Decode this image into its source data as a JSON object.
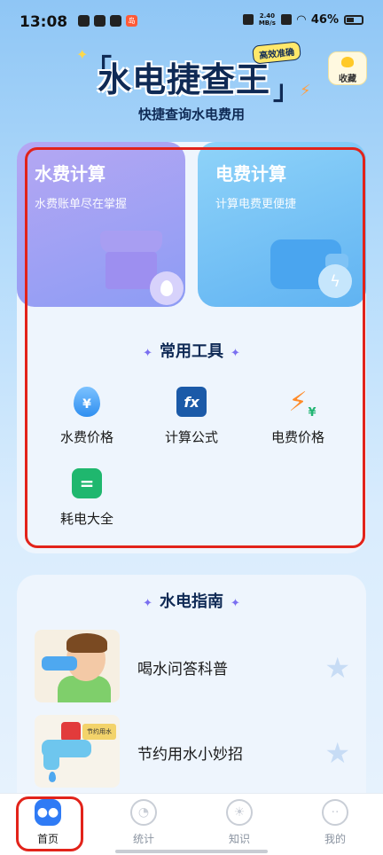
{
  "status_bar": {
    "time": "13:08",
    "net_speed_value": "2.40",
    "net_speed_unit": "MB/s",
    "battery": "46%",
    "app_badge_text": "岛"
  },
  "header": {
    "title": "水电捷查王",
    "badge": "高效准确",
    "subtitle": "快捷查询水电费用",
    "favorite_label": "收藏"
  },
  "calc_cards": {
    "water": {
      "title": "水费计算",
      "subtitle": "水费账单尽在掌握"
    },
    "electric": {
      "title": "电费计算",
      "subtitle": "计算电费更便捷"
    }
  },
  "tools": {
    "title": "常用工具",
    "items": [
      {
        "label": "水费价格",
        "icon": "water-price-icon",
        "glyph": "¥"
      },
      {
        "label": "计算公式",
        "icon": "formula-icon",
        "glyph": "fx"
      },
      {
        "label": "电费价格",
        "icon": "electric-price-icon",
        "glyph": "¥"
      },
      {
        "label": "耗电大全",
        "icon": "power-consumption-icon",
        "glyph": "="
      }
    ]
  },
  "guide": {
    "title": "水电指南",
    "items": [
      {
        "label": "喝水问答科普"
      },
      {
        "label": "节约用水小妙招",
        "sign_text": "节约用水"
      }
    ]
  },
  "tabbar": {
    "items": [
      {
        "label": "首页",
        "active": true
      },
      {
        "label": "统计",
        "active": false
      },
      {
        "label": "知识",
        "active": false
      },
      {
        "label": "我的",
        "active": false
      }
    ]
  },
  "colors": {
    "accent": "#2f7bf5",
    "highlight_box": "#e2231a",
    "title_navy": "#0f2a55"
  }
}
